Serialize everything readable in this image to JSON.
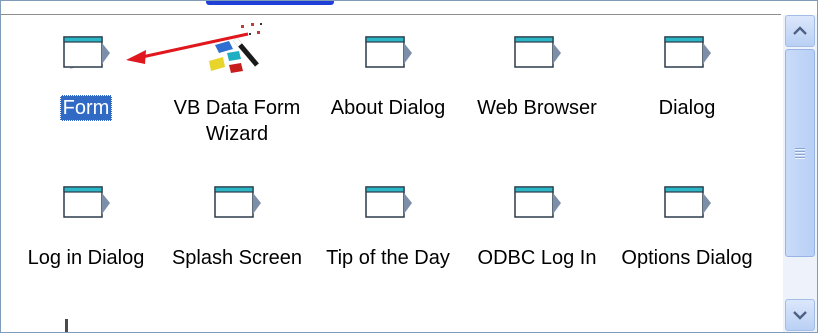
{
  "templates": [
    {
      "label": "Form",
      "icon": "form-icon",
      "selected": true
    },
    {
      "label": "VB Data Form Wizard",
      "icon": "wizard-icon",
      "selected": false
    },
    {
      "label": "About Dialog",
      "icon": "form-icon",
      "selected": false
    },
    {
      "label": "Web Browser",
      "icon": "form-icon",
      "selected": false
    },
    {
      "label": "Dialog",
      "icon": "form-icon",
      "selected": false
    },
    {
      "label": "Log in Dialog",
      "icon": "form-icon",
      "selected": false
    },
    {
      "label": "Splash Screen",
      "icon": "form-icon",
      "selected": false
    },
    {
      "label": "Tip of the Day",
      "icon": "form-icon",
      "selected": false
    },
    {
      "label": "ODBC Log In",
      "icon": "form-icon",
      "selected": false
    },
    {
      "label": "Options Dialog",
      "icon": "form-icon",
      "selected": false
    }
  ],
  "annotation": {
    "icon": "red-arrow-icon",
    "color": "#e0171d"
  },
  "colors": {
    "selection": "#316ac5",
    "icon_title_bar": "#2bb7c5",
    "scrollbar": "#b9d0f4"
  },
  "scrollbar": {
    "up_icon": "scroll-up-arrow-icon",
    "down_icon": "scroll-down-arrow-icon"
  }
}
